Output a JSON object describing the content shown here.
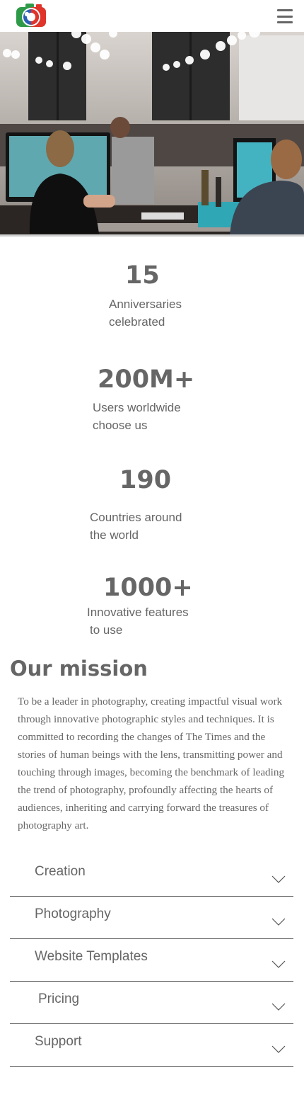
{
  "header": {
    "logo_icon": "camera-logo-icon",
    "menu_icon": "hamburger-menu-icon"
  },
  "hero": {
    "image_description_icon": "office-workspace-photo"
  },
  "stats": [
    {
      "number": "15",
      "label_line1": "Anniversaries",
      "label_line2": "celebrated"
    },
    {
      "number": "200M+",
      "label_line1": "Users worldwide",
      "label_line2": "choose us"
    },
    {
      "number": "190",
      "label_line1": "Countries around",
      "label_line2": "the world"
    },
    {
      "number": "1000+",
      "label_line1": "Innovative features",
      "label_line2": "to use"
    }
  ],
  "mission": {
    "title": "Our mission",
    "text": "To be a leader in photography, creating impactful visual work through innovative photographic styles and techniques. It is committed to recording the changes of The Times and the stories of human beings with the lens, transmitting power and touching through images, becoming the benchmark of leading the trend of photography, profoundly affecting the hearts of audiences, inheriting and carrying forward the treasures of photography art."
  },
  "accordion": [
    {
      "label": "Creation",
      "icon": "chevron-down-icon"
    },
    {
      "label": "Photography",
      "icon": "chevron-down-icon"
    },
    {
      "label": "Website Templates",
      "icon": "chevron-down-icon"
    },
    {
      "label": "Pricing",
      "icon": "chevron-down-icon"
    },
    {
      "label": "Support",
      "icon": "chevron-down-icon"
    }
  ],
  "colors": {
    "text": "#666666",
    "divider": "#555555",
    "logo_green": "#2e9a48",
    "logo_red": "#e0342b",
    "logo_blue": "#2b5fb5"
  }
}
